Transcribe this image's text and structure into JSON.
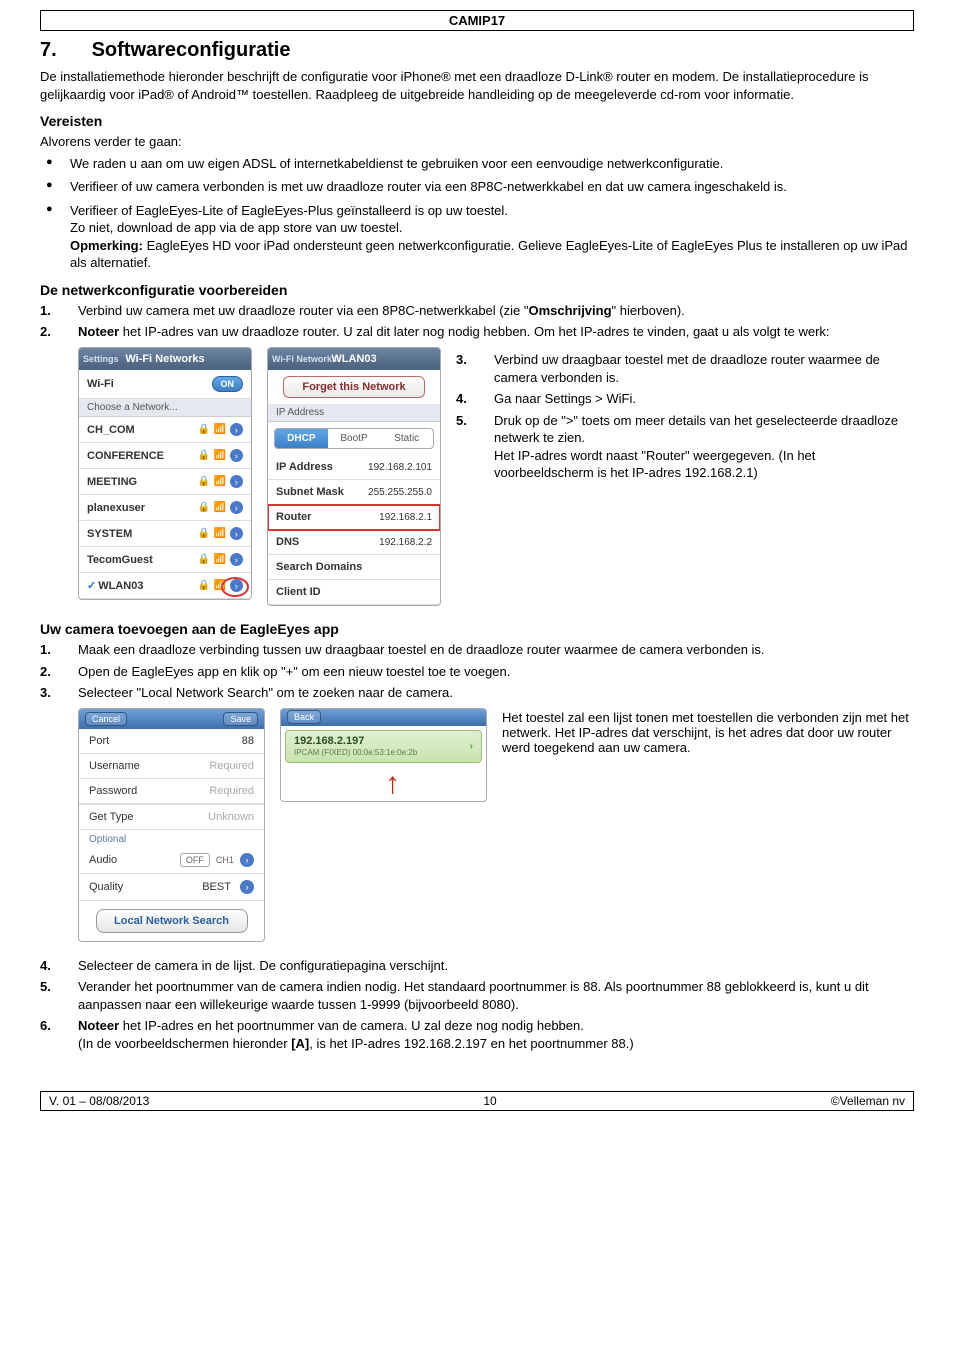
{
  "header": {
    "doc_code": "CAMIP17"
  },
  "section": {
    "number": "7.",
    "title": "Softwareconfiguratie"
  },
  "intro": "De installatiemethode hieronder beschrijft de configuratie voor iPhone® met een draadloze D-Link® router en modem. De installatieprocedure is gelijkaardig voor iPad® of Android™ toestellen. Raadpleeg de uitgebreide handleiding op de meegeleverde cd-rom voor informatie.",
  "req_heading": "Vereisten",
  "req_lead": "Alvorens verder te gaan:",
  "req_items": [
    "We raden u aan om uw eigen ADSL of internetkabeldienst te gebruiken voor een eenvoudige netwerkconfiguratie.",
    "Verifieer of uw camera verbonden is met uw draadloze router via een 8P8C-netwerkkabel en dat uw camera ingeschakeld is.",
    "Verifieer of EagleEyes-Lite of EagleEyes-Plus geïnstalleerd is op uw toestel.\nZo niet, download de app via de app store van uw toestel.\n<b>Opmerking:</b> EagleEyes HD voor iPad ondersteunt geen netwerkconfiguratie. Gelieve EagleEyes-Lite of EagleEyes Plus te installeren op uw iPad als alternatief."
  ],
  "prep_heading": "De netwerkconfiguratie voorbereiden",
  "prep_steps": {
    "s1_pre": "Verbind uw camera met uw draadloze router via een 8P8C-netwerkkabel (zie \"",
    "s1_bold": "Omschrijving",
    "s1_post": "\" hierboven).",
    "s2_bold": "Noteer",
    "s2_post": " het IP-adres van uw draadloze router. U zal dit later nog nodig hebben. Om het IP-adres te vinden, gaat u als volgt te werk:",
    "s3": "Verbind uw draagbaar toestel met de draadloze router waarmee de camera verbonden is.",
    "s4": "Ga naar Settings > WiFi.",
    "s5": "Druk op de \">\" toets om meer details van het geselecteerde draadloze netwerk te zien.\nHet IP-adres wordt naast \"Router\" weergegeven. (In het voorbeeldscherm is het IP-adres 192.168.2.1)"
  },
  "wifi_panel": {
    "topbar_left": "Settings",
    "topbar_title": "Wi-Fi Networks",
    "wifi_label": "Wi-Fi",
    "wifi_toggle": "ON",
    "choose": "Choose a Network...",
    "nets": [
      "CH_COM",
      "CONFERENCE",
      "MEETING",
      "planexuser",
      "SYSTEM",
      "TecomGuest",
      "WLAN03"
    ],
    "selected": "WLAN03"
  },
  "detail_panel": {
    "topbar_left": "Wi-Fi Networks",
    "topbar_title": "WLAN03",
    "forget": "Forget this Network",
    "ip_section": "IP Address",
    "dhcp": "DHCP",
    "bootp": "BootP",
    "static": "Static",
    "rows": {
      "ip_lbl": "IP Address",
      "ip_val": "192.168.2.101",
      "mask_lbl": "Subnet Mask",
      "mask_val": "255.255.255.0",
      "router_lbl": "Router",
      "router_val": "192.168.2.1",
      "dns_lbl": "DNS",
      "dns_val": "192.168.2.2",
      "search_lbl": "Search Domains",
      "client_lbl": "Client ID"
    }
  },
  "add_heading": "Uw camera toevoegen aan de EagleEyes app",
  "add_steps": {
    "s1": "Maak een draadloze verbinding tussen uw draagbaar toestel en de draadloze router waarmee de camera verbonden is.",
    "s2": "Open de EagleEyes app en klik op \"+\" om een nieuw toestel toe te voegen.",
    "s3": "Selecteer \"Local Network Search\" om te zoeken naar de camera."
  },
  "eagle_panel": {
    "cancel": "Cancel",
    "save": "Save",
    "port_k": "Port",
    "port_v": "88",
    "user_k": "Username",
    "user_v": "Required",
    "pass_k": "Password",
    "pass_v": "Required",
    "gettype_k": "Get Type",
    "gettype_v": "Unknown",
    "optional": "Optional",
    "audio_k": "Audio",
    "audio_off": "OFF",
    "audio_ch": "CH1",
    "quality_k": "Quality",
    "quality_v": "BEST",
    "lns": "Local Network Search"
  },
  "search_panel": {
    "back": "Back",
    "ip": "192.168.2.197",
    "mac": "IPCAM (FIXED)  00:0e:53:1e:0e:2b"
  },
  "right_caption": "Het toestel zal een lijst tonen met toestellen die verbonden zijn met het netwerk. Het IP-adres dat verschijnt, is het adres dat door uw router werd toegekend aan uw camera.",
  "tail_steps": {
    "s4": "Selecteer de camera in de lijst. De configuratiepagina verschijnt.",
    "s5": "Verander het poortnummer van de camera indien nodig. Het standaard poortnummer is 88. Als poortnummer 88 geblokkeerd is, kunt u dit aanpassen naar een willekeurige waarde tussen 1-9999 (bijvoorbeeld 8080).",
    "s6_bold": "Noteer",
    "s6_post": " het IP-adres en het poortnummer van de camera. U zal deze nog nodig hebben.\n(In de voorbeeldschermen hieronder ",
    "s6_bold2": "[A]",
    "s6_post2": ", is het IP-adres 192.168.2.197 en het poortnummer 88.)"
  },
  "footer": {
    "left": "V. 01 – 08/08/2013",
    "mid": "10",
    "right": "©Velleman nv"
  }
}
